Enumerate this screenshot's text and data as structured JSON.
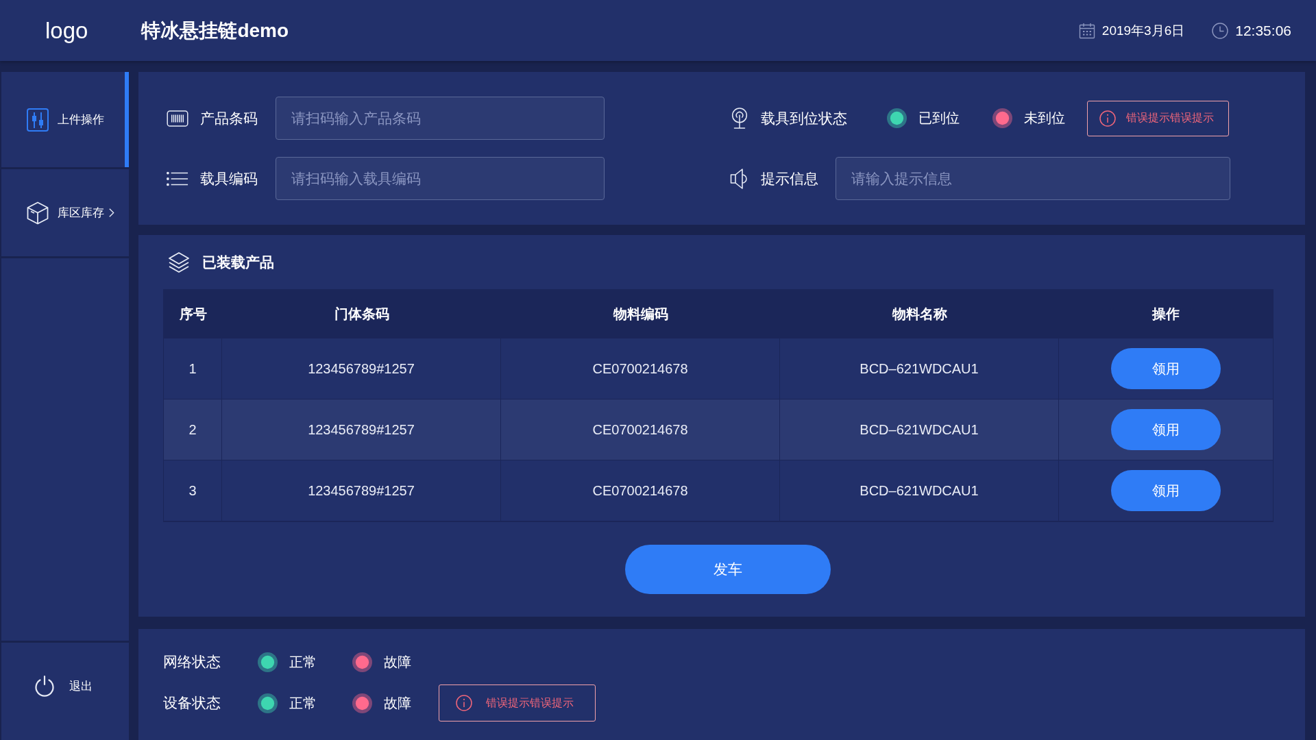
{
  "header": {
    "logo": "logo",
    "title": "特冰悬挂链demo",
    "date": "2019年3月6日",
    "time": "12:35:06"
  },
  "sidebar": {
    "items": [
      {
        "label": "上件操作",
        "selected": true,
        "has_submenu": false
      },
      {
        "label": "库区库存",
        "selected": false,
        "has_submenu": true
      }
    ],
    "logout": "退出"
  },
  "scan_panel": {
    "fields": [
      {
        "label": "产品条码",
        "placeholder": "请扫码输入产品条码"
      },
      {
        "label": "载具编码",
        "placeholder": "请扫码输入载具编码"
      }
    ],
    "carrier_status": {
      "label": "载具到位状态",
      "states": [
        {
          "label": "已到位",
          "color": "#3ed6b0"
        },
        {
          "label": "未到位",
          "color": "#ff6a8d"
        }
      ],
      "error": "错误提示错误提示"
    },
    "hint": {
      "label": "提示信息",
      "placeholder": "请输入提示信息"
    }
  },
  "loaded_panel": {
    "title": "已装载产品",
    "table": {
      "columns": [
        "序号",
        "门体条码",
        "物料编码",
        "物料名称",
        "操作"
      ],
      "rows": [
        {
          "cells": [
            "1",
            "123456789#1257",
            "CE0700214678",
            "BCD–621WDCAU1"
          ],
          "action": "领用"
        },
        {
          "cells": [
            "2",
            "123456789#1257",
            "CE0700214678",
            "BCD–621WDCAU1"
          ],
          "action": "领用"
        },
        {
          "cells": [
            "3",
            "123456789#1257",
            "CE0700214678",
            "BCD–621WDCAU1"
          ],
          "action": "领用"
        }
      ]
    },
    "submit": "发车"
  },
  "status_panel": {
    "rows": [
      {
        "label": "网络状态",
        "states": [
          {
            "label": "正常",
            "color": "#3ed6b0"
          },
          {
            "label": "故障",
            "color": "#ff6a8d"
          }
        ]
      },
      {
        "label": "设备状态",
        "states": [
          {
            "label": "正常",
            "color": "#3ed6b0"
          },
          {
            "label": "故障",
            "color": "#ff6a8d"
          }
        ],
        "error": "错误提示错误提示"
      }
    ]
  }
}
